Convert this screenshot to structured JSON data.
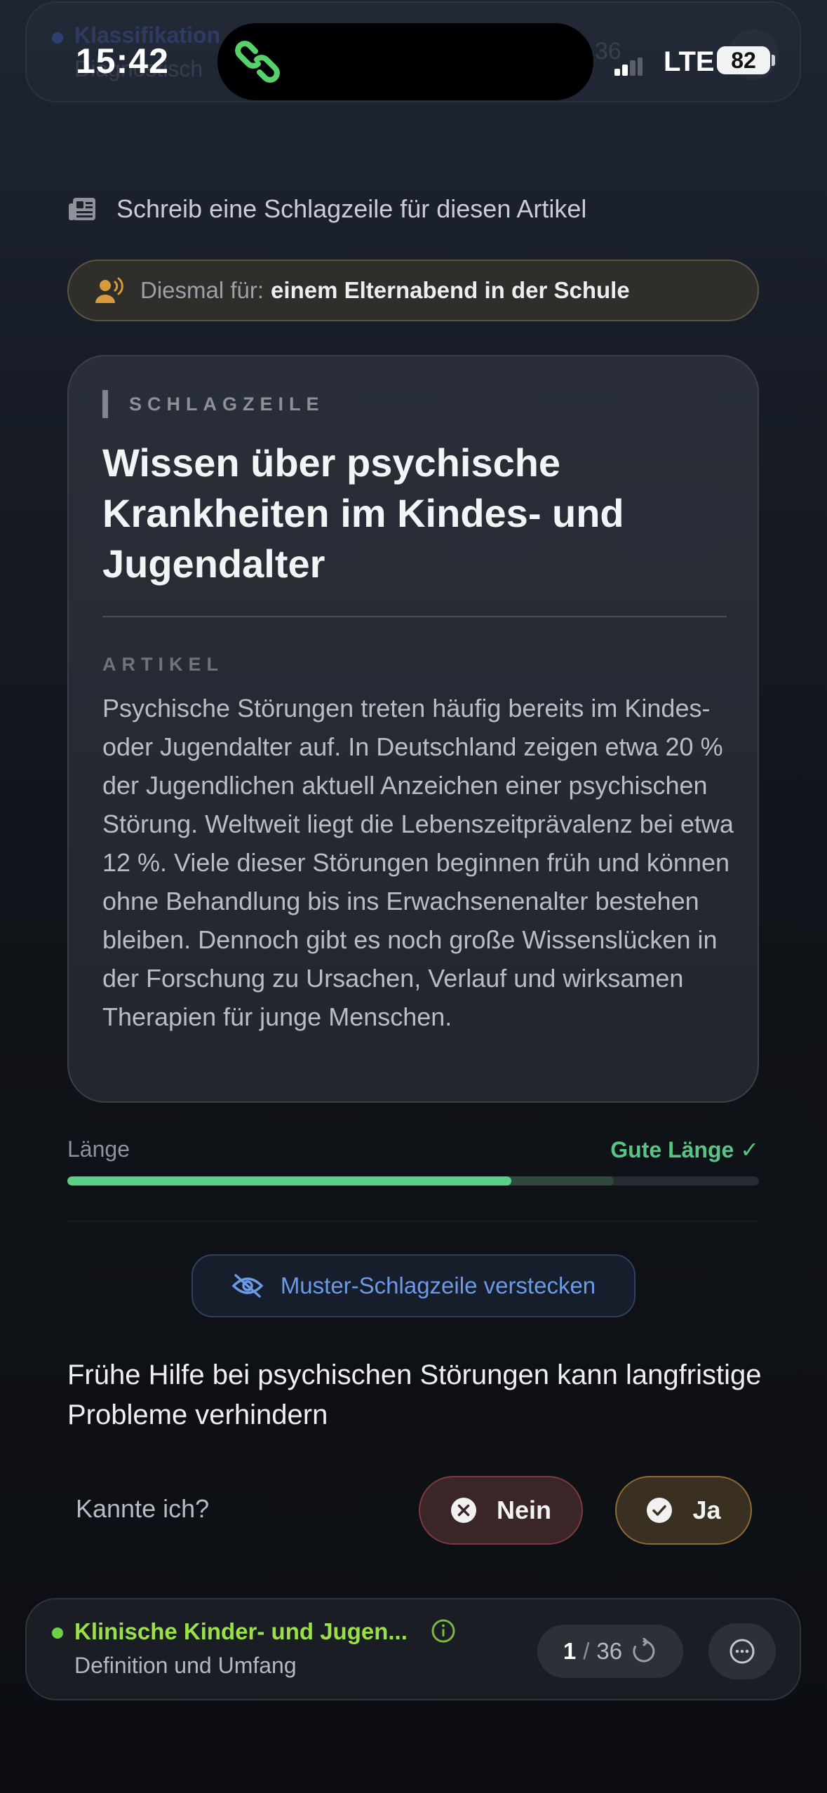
{
  "status_bar": {
    "time": "15:42",
    "network": "LTE",
    "battery": "82"
  },
  "ghost_card": {
    "title": "Klassifikation",
    "subtitle": "Diagnostisch",
    "counter": "36"
  },
  "prompt": {
    "text": "Schreib eine Schlagzeile für diesen Artikel",
    "icon": "newspaper-icon"
  },
  "audience": {
    "label": "Diesmal für:",
    "value": "einem Elternabend in der Schule",
    "icon": "speaking-person-icon"
  },
  "card": {
    "headline_label": "SCHLAGZEILE",
    "headline": "Wissen über psychische Krankheiten im Kindes- und Jugendalter",
    "article_label": "ARTIKEL",
    "article": "Psychische Störungen treten häufig bereits im Kindes- oder Jugendalter auf. In Deutschland zeigen etwa 20 % der Jugendlichen aktuell Anzeichen einer psychischen Störung. Weltweit liegt die Lebens­zeitprävalenz bei etwa 12 %. Viele dieser Störungen beginnen früh und können ohne Behandlung bis ins Erwachsenenalter bestehen bleiben. Dennoch gibt es noch große Wissenslücken in der Forschung zu Ursachen, Verlauf und wirksamen Therapien für junge Menschen."
  },
  "length": {
    "label": "Länge",
    "status": "Gute Länge ✓",
    "fill_fraction": 0.642,
    "target_fraction": 0.79,
    "color": "#5ccf86"
  },
  "hide_button": {
    "label": "Muster-Schlagzeile verstecken",
    "icon": "eye-slash-icon"
  },
  "sample_headline": "Frühe Hilfe bei psychischen Störungen kann langfristige Probleme verhindern",
  "knew": {
    "question": "Kannte ich?",
    "no_label": "Nein",
    "yes_label": "Ja",
    "no_icon": "x-circle-icon",
    "yes_icon": "check-circle-icon"
  },
  "bottom_bar": {
    "topic": "Klinische Kinder- und Jugen...",
    "subtopic": "Definition und Umfang",
    "current": "1",
    "separator": "/",
    "total": "36",
    "topic_color": "#9bdf4a"
  }
}
